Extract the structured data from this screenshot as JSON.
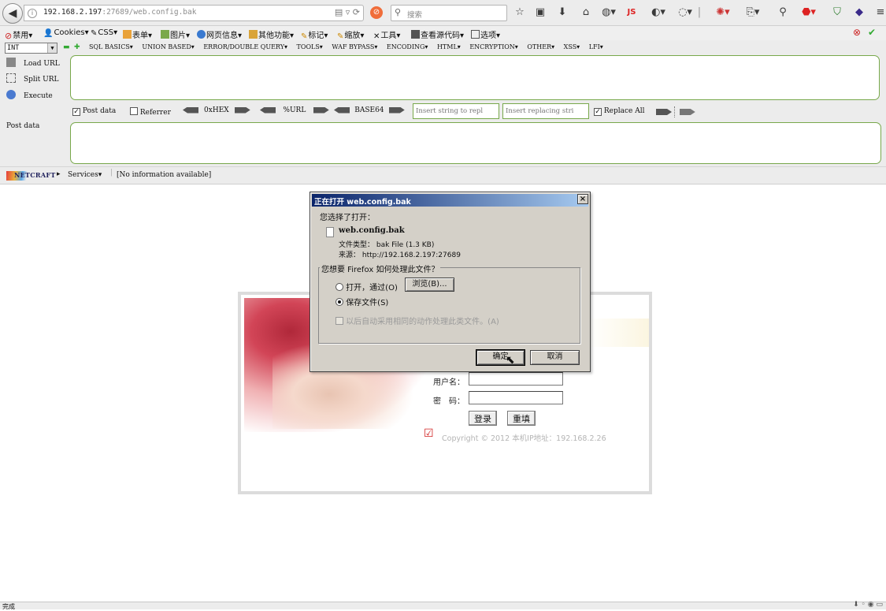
{
  "browser": {
    "url_host": "192.168.2.197",
    "url_rest": ":27689/web.config.bak",
    "search_placeholder": "搜索"
  },
  "menubar": {
    "items": [
      "禁用▾",
      "Cookies▾",
      "CSS▾",
      "表单▾",
      "图片▾",
      "网页信息▾",
      "其他功能▾",
      "标记▾",
      "缩放▾",
      "工具▾",
      "查看源代码▾",
      "选项▾"
    ]
  },
  "hackbar": {
    "select_value": "INT",
    "menu": [
      "SQL BASICS▾",
      "UNION BASED▾",
      "ERROR/DOUBLE QUERY▾",
      "TOOLS▾",
      "WAF BYPASS▾",
      "ENCODING▾",
      "HTML▾",
      "ENCRYPTION▾",
      "OTHER▾",
      "XSS▾",
      "LFI▾"
    ],
    "load_url": "Load URL",
    "split_url": "Split URL",
    "execute": "Execute",
    "post_data_cb": "Post data",
    "referrer_cb": "Referrer",
    "hex_label": "0xHEX",
    "url_label": "%URL",
    "base64_label": "BASE64",
    "insert_string_placeholder": "Insert string to repl",
    "insert_replacing_placeholder": "Insert replacing stri",
    "replace_all": "Replace All",
    "post_data_label": "Post data",
    "netcraft_logo": "NETCRAFT",
    "services": "Services▾",
    "info": "[No information available]"
  },
  "login": {
    "username_label": "用户名：",
    "password_label": "密　码：",
    "login_button": "登录",
    "reset_button": "重填",
    "copyright": "Copyright © 2012 本机IP地址：192.168.2.26"
  },
  "dialog": {
    "title": "正在打开 web.config.bak",
    "close": "×",
    "you_chose": "您选择了打开：",
    "filename": "web.config.bak",
    "filetype": "文件类型：  bak File (1.3 KB)",
    "source": "来源：  http://192.168.2.197:27689",
    "question": "您想要 Firefox 如何处理此文件？",
    "open_with": "打开，通过(O)",
    "browse": "浏览(B)...",
    "save_file": "保存文件(S)",
    "auto_action": "以后自动采用相同的动作处理此类文件。(A)",
    "ok": "确定",
    "cancel": "取消"
  },
  "status": {
    "text": "完成"
  }
}
